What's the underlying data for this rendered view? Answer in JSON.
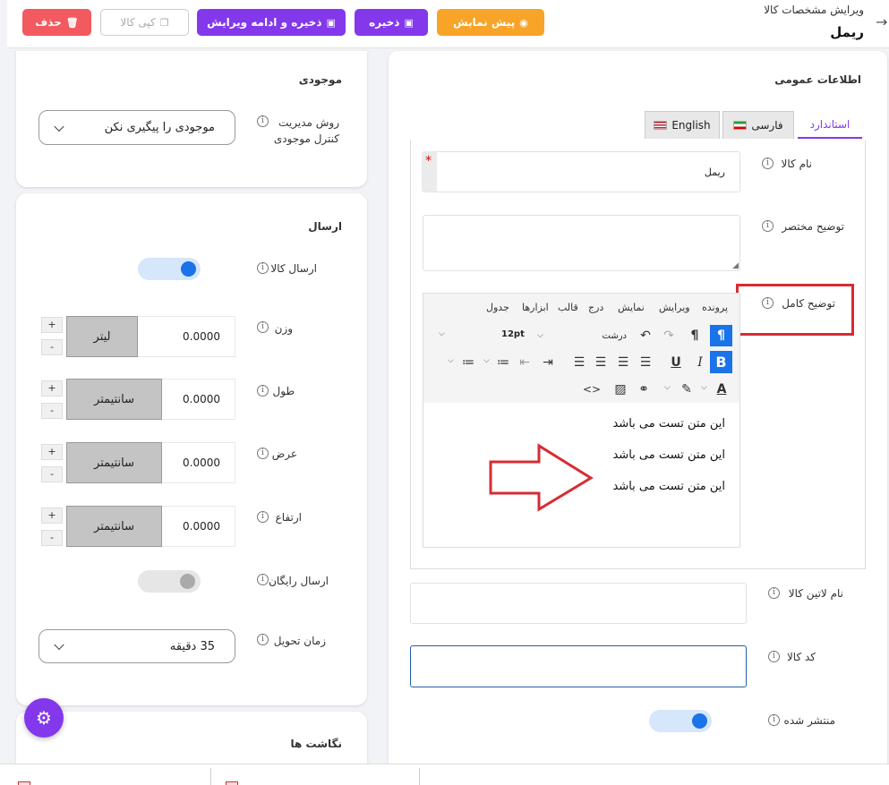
{
  "header": {
    "breadcrumb": "ویرایش مشخصات کالا",
    "title": "ریمل",
    "buttons": {
      "delete": "حذف",
      "copy": "کپی کالا",
      "save_continue": "ذخیره و ادامه ویرایش",
      "save": "ذخیره",
      "preview": "پیش نمایش"
    }
  },
  "general": {
    "section_title": "اطلاعات عمومی",
    "tabs": [
      "استاندارد",
      "فارسی",
      "English"
    ],
    "product_name_label": "نام کالا",
    "product_name_value": "ریمل",
    "required_mark": "*",
    "short_desc_label": "توضیح مختصر",
    "full_desc_label": "توضیح کامل",
    "latin_name_label": "نام لاتین کالا",
    "code_label": "کد کالا",
    "published_label": "منتشر شده",
    "published": true
  },
  "editor": {
    "menu": [
      "پرونده",
      "ویرایش",
      "نمایش",
      "درج",
      "قالب",
      "ابزارها",
      "جدول"
    ],
    "font_size": "12pt",
    "format": "درشت",
    "content": [
      "این متن تست می باشد",
      "این متن تست می باشد",
      "این متن تست می باشد"
    ]
  },
  "stock": {
    "section_title": "موجودی",
    "method_label": "روش مدیریت کنترل موجودی",
    "method_value": "موجودی را پیگیری نکن"
  },
  "shipping": {
    "section_title": "ارسال",
    "ship_label": "ارسال کالا",
    "ship_enabled": true,
    "weight_label": "وزن",
    "weight_value": "0.0000",
    "weight_unit": "لیتر",
    "length_label": "طول",
    "length_value": "0.0000",
    "length_unit": "سانتیمتر",
    "width_label": "عرض",
    "width_value": "0.0000",
    "width_unit": "سانتیمتر",
    "height_label": "ارتفاع",
    "height_value": "0.0000",
    "height_unit": "سانتیمتر",
    "free_label": "ارسال رایگان",
    "free_enabled": false,
    "delivery_label": "زمان تحویل",
    "delivery_value": "35 دقیقه",
    "plus": "+",
    "minus": "-"
  },
  "notes": {
    "section_title": "نگاشت ها"
  },
  "colors": {
    "primary": "#8338ec",
    "warning": "#f7a428",
    "danger": "#f35a5f",
    "toggle_on": "#1a73e8",
    "annotation": "#d62c33"
  }
}
